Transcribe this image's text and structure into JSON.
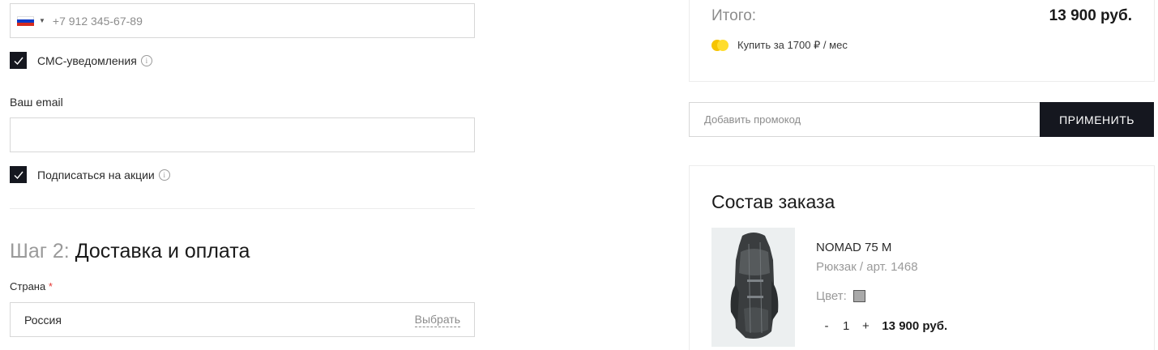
{
  "contact": {
    "phone_value": "+7 912 345-67-89",
    "sms_label": "СМС-уведомления",
    "sms_checked": true,
    "email_label": "Ваш email",
    "email_value": "",
    "subscribe_label": "Подписаться на акции",
    "subscribe_checked": true,
    "info_glyph": "i"
  },
  "step2": {
    "prefix": "Шаг 2:",
    "title": "Доставка и оплата",
    "country_label": "Страна",
    "required_mark": "*",
    "country_value": "Россия",
    "choose_label": "Выбрать"
  },
  "summary": {
    "total_label": "Итого:",
    "total_value": "13 900 руб.",
    "installment_text": "Купить за 1700 ₽ / мес"
  },
  "promo": {
    "placeholder": "Добавить промокод",
    "apply_label": "ПРИМЕНИТЬ"
  },
  "order": {
    "title": "Состав заказа",
    "items": [
      {
        "name": "NOMAD 75 M",
        "subtitle": "Рюкзак / арт. 1468",
        "color_label": "Цвет:",
        "color_hex": "#a9a9a9",
        "minus": "-",
        "quantity": "1",
        "plus": "+",
        "price": "13 900 руб."
      }
    ]
  },
  "colors": {
    "dark": "#15171f",
    "border": "#d7d7d7",
    "muted_text": "#8c8c8c",
    "required": "#e53935",
    "coin_yellow": "#ffdd2d"
  }
}
